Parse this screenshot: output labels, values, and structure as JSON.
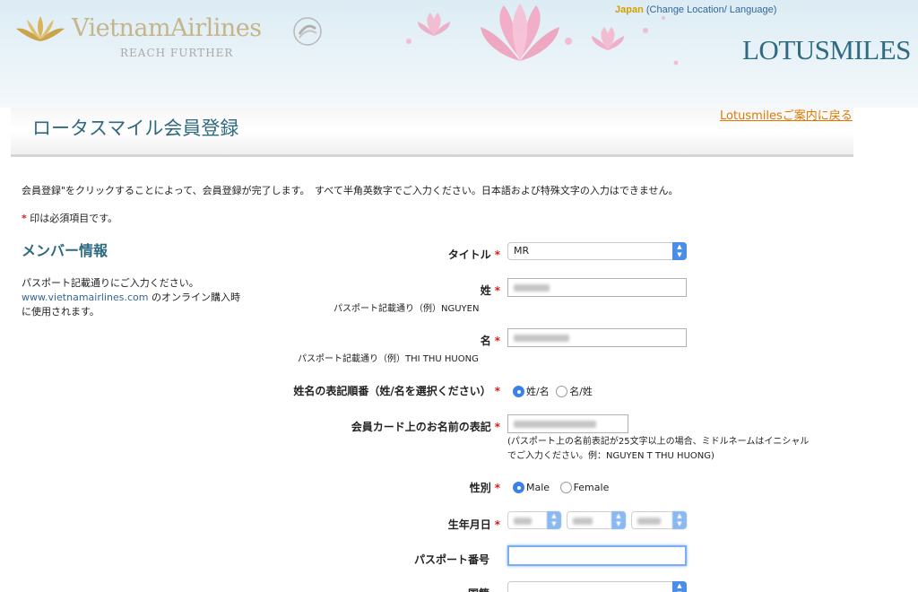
{
  "header": {
    "brand": "VietnamAirlines",
    "tagline": "REACH FURTHER",
    "location_country": "Japan",
    "location_change": "(Change Location/ Language)",
    "program_logo": "LOTUSMILES",
    "back_link": "Lotusmilesご案内に戻る"
  },
  "page": {
    "title": "ロータスマイル会員登録",
    "intro": "会員登録\"をクリックすることによって、会員登録が完了します。　すべて半角英数字でご入力ください。日本語および特殊文字の入力はできません。",
    "required_star": "*",
    "required_note": " 印は必須項目です。"
  },
  "section": {
    "title": "メンバー情報",
    "desc_line1": "パスポート記載通りにご入力ください。",
    "desc_site": "www.vietnamairlines.com",
    "desc_line2": " のオンライン購入時",
    "desc_line3": "に使用されます。"
  },
  "form": {
    "title_label": "タイトル",
    "title_value": "MR",
    "last_name_label": "姓",
    "last_name_hint": "パスポート記載通り（例）NGUYEN",
    "first_name_label": "名",
    "first_name_hint": "パスポート記載通り（例）THI THU HUONG",
    "name_order_label": "姓名の表記順番（姓/名を選択ください）",
    "name_order_options": [
      "姓/名",
      "名/姓"
    ],
    "card_name_label": "会員カード上のお名前の表記",
    "card_name_hint_1": "(パスポート上の名前表記が25文字以上の場合、ミドルネームはイニシャル",
    "card_name_hint_2": "でご入力ください。例：NGUYEN T THU HUONG)",
    "gender_label": "性別",
    "gender_options": [
      "Male",
      "Female"
    ],
    "birthdate_label": "生年月日",
    "passport_label": "パスポート番号",
    "nationality_label": "国籍"
  },
  "colors": {
    "brand_teal": "#2e6a80",
    "link_orange": "#e07800",
    "required_red": "#d02020",
    "accent_blue": "#3b82e8"
  }
}
